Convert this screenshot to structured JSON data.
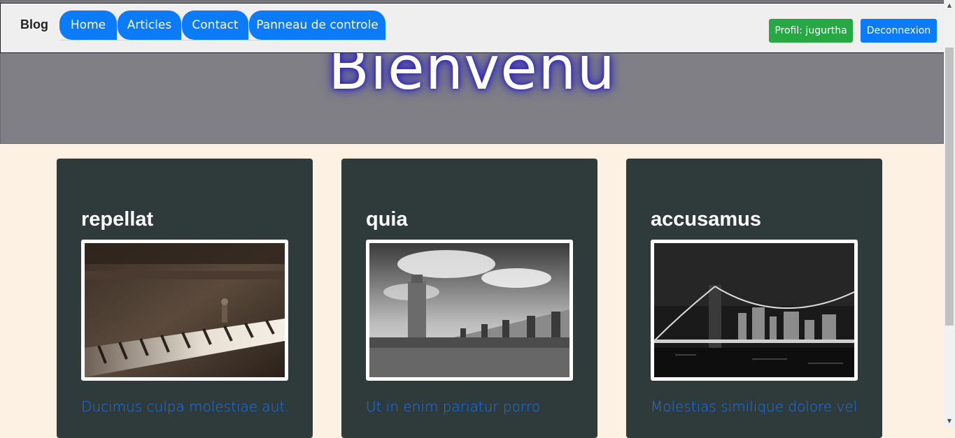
{
  "hero": {
    "title": "Bienvenu"
  },
  "navbar": {
    "brand": "Blog",
    "items": [
      {
        "label": "Home"
      },
      {
        "label": "Articles"
      },
      {
        "label": "Contact"
      },
      {
        "label": "Panneau de controle"
      }
    ],
    "profile_label": "Profil: jugurtha",
    "logout_label": "Deconnexion"
  },
  "cards": [
    {
      "title": "repellat",
      "image": "piano-photo",
      "excerpt": "Ducimus culpa molestiae aut."
    },
    {
      "title": "quia",
      "image": "mosque-courtyard-photo",
      "excerpt": "Ut in enim pariatur porro"
    },
    {
      "title": "accusamus",
      "image": "bridge-night-photo",
      "excerpt": "Molestias similique dolore vel"
    }
  ],
  "colors": {
    "nav_pill": "#0b7bfa",
    "profile_button": "#28a745",
    "logout_button": "#0b7bfa",
    "card_background": "#2e3b3a",
    "page_background": "#fdf1e3",
    "hero_background": "#807f85",
    "excerpt_text": "#1e72e6"
  }
}
